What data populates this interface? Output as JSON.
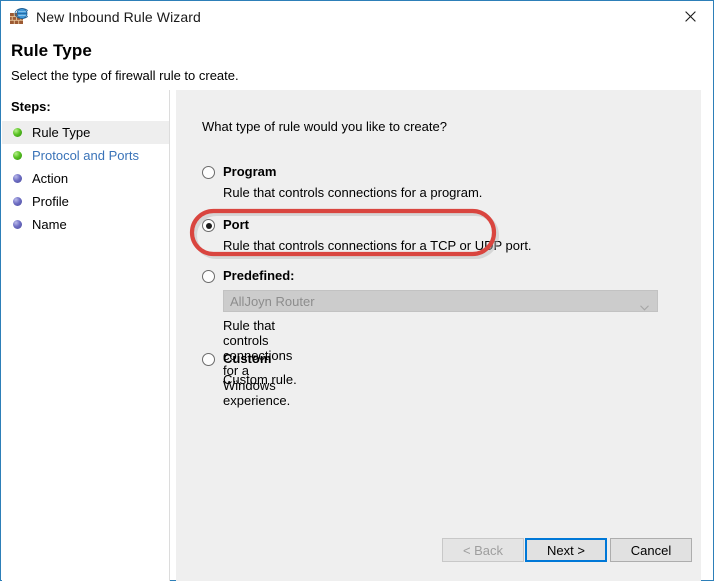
{
  "window": {
    "title": "New Inbound Rule Wizard",
    "icon": "firewall-globe-icon",
    "close_label": "✕",
    "border_color": "#2d7fb8"
  },
  "header": {
    "title": "Rule Type",
    "subtitle": "Select the type of firewall rule to create."
  },
  "sidebar": {
    "label": "Steps:",
    "items": [
      {
        "label": "Rule Type",
        "state": "current",
        "bullet": "green"
      },
      {
        "label": "Protocol and Ports",
        "state": "link",
        "bullet": "green"
      },
      {
        "label": "Action",
        "state": "pending",
        "bullet": "blue"
      },
      {
        "label": "Profile",
        "state": "pending",
        "bullet": "blue"
      },
      {
        "label": "Name",
        "state": "pending",
        "bullet": "blue"
      }
    ]
  },
  "main": {
    "question": "What type of rule would you like to create?",
    "options": [
      {
        "id": "program",
        "title": "Program",
        "description": "Rule that controls connections for a program.",
        "selected": false
      },
      {
        "id": "port",
        "title": "Port",
        "description": "Rule that controls connections for a TCP or UDP port.",
        "selected": true,
        "highlighted": true
      },
      {
        "id": "predefined",
        "title": "Predefined:",
        "description": "Rule that controls connections for a Windows experience.",
        "selected": false,
        "combo": {
          "value": "AllJoyn Router",
          "disabled": true,
          "arrow": "chevron-down-icon"
        }
      },
      {
        "id": "custom",
        "title": "Custom",
        "description": "Custom rule.",
        "selected": false
      }
    ]
  },
  "footer": {
    "back_label": "< Back",
    "back_disabled": true,
    "next_label": "Next >",
    "next_default": true,
    "cancel_label": "Cancel"
  },
  "annotation": {
    "type": "red-oval-highlight",
    "target": "port-option",
    "color": "#d9453f"
  }
}
